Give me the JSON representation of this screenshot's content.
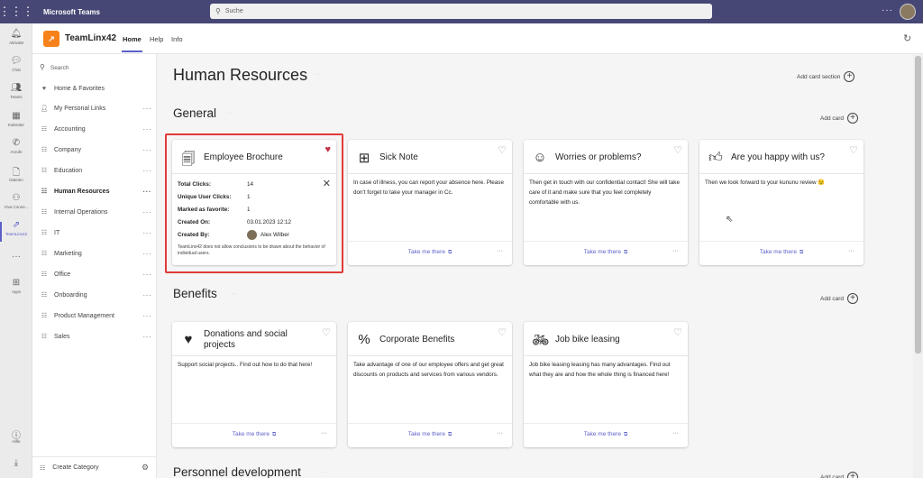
{
  "topbar": {
    "brand": "Microsoft Teams",
    "search_placeholder": "Suche"
  },
  "rail": [
    {
      "label": "Aktivität",
      "icon": "bell-icon"
    },
    {
      "label": "Chat",
      "icon": "chat-icon"
    },
    {
      "label": "Teams",
      "icon": "teams-icon"
    },
    {
      "label": "Kalender",
      "icon": "calendar-icon"
    },
    {
      "label": "Anrufe",
      "icon": "phone-icon"
    },
    {
      "label": "Dateien",
      "icon": "file-icon"
    },
    {
      "label": "Viva Conne...",
      "icon": "viva-icon"
    },
    {
      "label": "TeamLinx42",
      "icon": "teamlinx-icon"
    },
    {
      "label": "Apps",
      "icon": "apps-icon"
    },
    {
      "label": "Hilfe",
      "icon": "help-icon"
    }
  ],
  "app": {
    "name": "TeamLinx42",
    "tabs": [
      "Home",
      "Help",
      "Info"
    ]
  },
  "sidebar": {
    "search": "Search",
    "items": [
      "Home & Favorites",
      "My Personal Links",
      "Accounting",
      "Company",
      "Education",
      "Human Resources",
      "Internal Operations",
      "IT",
      "Marketing",
      "Office",
      "Onboarding",
      "Product Management",
      "Sales"
    ],
    "footer": "Create Category"
  },
  "main": {
    "title": "Human Resources",
    "add_card_section": "Add card section",
    "add_card": "Add card",
    "take_me_there": "Take me there",
    "sections": [
      "General",
      "Benefits",
      "Personnel development"
    ]
  },
  "cards": {
    "brochure": {
      "title": "Employee Brochure",
      "stats": [
        {
          "k": "Total Clicks:",
          "v": "14"
        },
        {
          "k": "Unique User Clicks:",
          "v": "1"
        },
        {
          "k": "Marked as favorite:",
          "v": "1"
        },
        {
          "k": "Created On:",
          "v": "03.01.2023 12:12"
        },
        {
          "k": "Created By:",
          "v": "Alex Wilber"
        }
      ],
      "disclaimer": "TeamLinx42 does not allow conclusions to be drawn about the behavior of individual users."
    },
    "sick": {
      "title": "Sick Note",
      "body": "In case of illness, you can report your absence here. Please don't forget to take your manager in Cc."
    },
    "worries": {
      "title": "Worries or problems?",
      "body": "Then get in touch with our confidential contact! She will take care of it and make sure that you feel completely comfortable with us."
    },
    "happy": {
      "title": "Are you happy with us?",
      "body": "Then we look forward to your kununu review 😉"
    },
    "donations": {
      "title": "Donations and social projects",
      "body": "Support social projects.. Find out how to do that here!"
    },
    "corporate": {
      "title": "Corporate Benefits",
      "body": "Take advantage of one of our employee offers and get great discounts on products and services from various vendors."
    },
    "bike": {
      "title": "Job bike leasing",
      "body": "Job bike leasing leasing has many advantages. Find out what they are and how the whole thing is financed here!"
    }
  }
}
